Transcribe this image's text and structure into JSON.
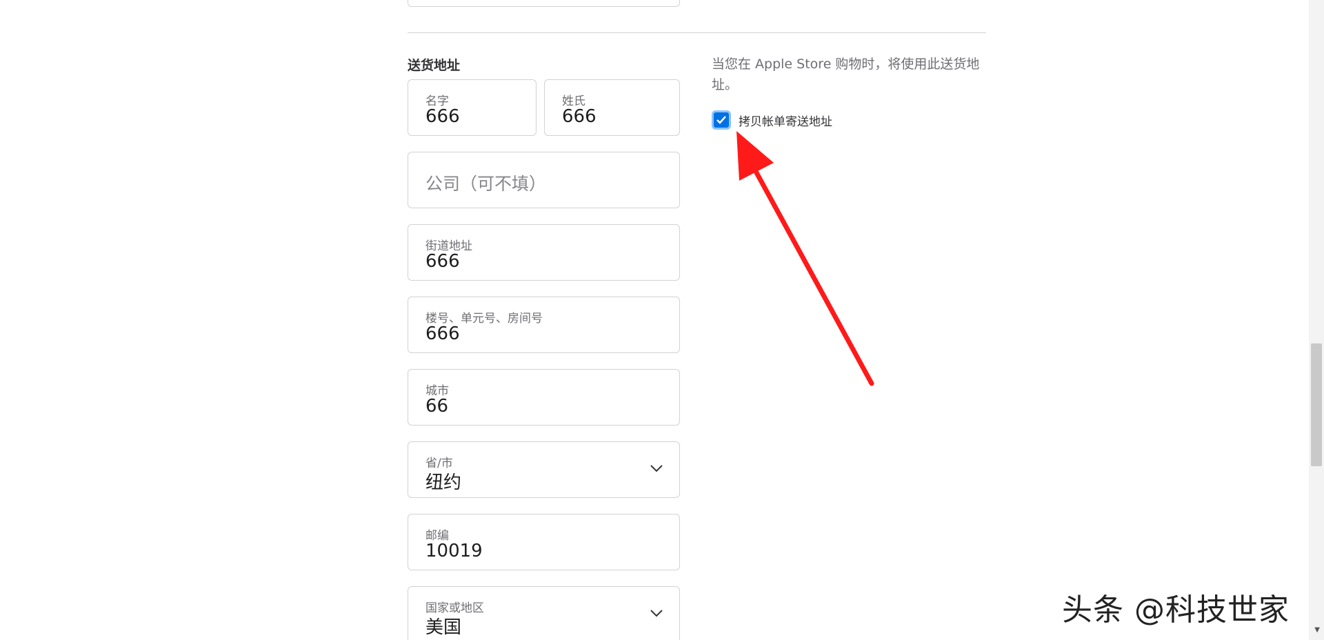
{
  "shipping": {
    "section_title": "送货地址",
    "hint": "当您在 Apple Store 购物时，将使用此送货地址。",
    "copy_billing_label": "拷贝帐单寄送地址",
    "copy_billing_checked": true,
    "fields": {
      "first_name": {
        "label": "名字",
        "value": "666"
      },
      "last_name": {
        "label": "姓氏",
        "value": "666"
      },
      "company": {
        "placeholder": "公司（可不填）"
      },
      "street": {
        "label": "街道地址",
        "value": "666"
      },
      "unit": {
        "label": "楼号、单元号、房间号",
        "value": "666"
      },
      "city": {
        "label": "城市",
        "value": "66"
      },
      "state": {
        "label": "省/市",
        "value": "纽约"
      },
      "zip": {
        "label": "邮编",
        "value": "10019"
      },
      "country": {
        "label": "国家或地区",
        "value": "美国"
      }
    }
  },
  "watermark": "头条 @科技世家",
  "colors": {
    "accent": "#0071e3",
    "arrow": "#ff1a1a"
  }
}
